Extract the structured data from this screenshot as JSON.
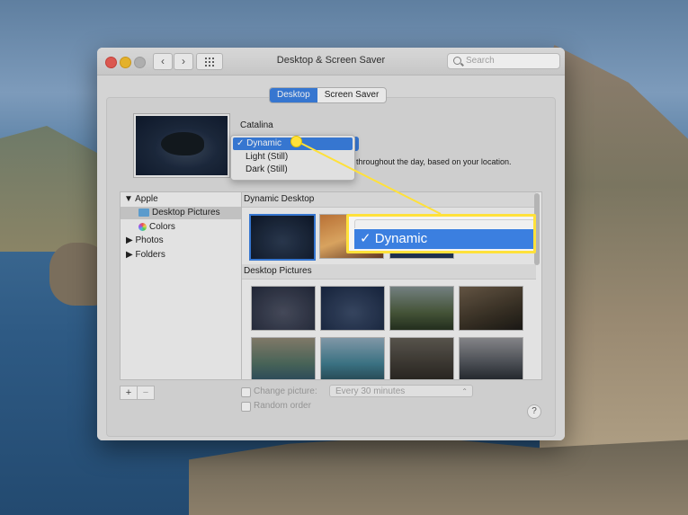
{
  "window": {
    "title": "Desktop & Screen Saver",
    "back_glyph": "‹",
    "forward_glyph": "›",
    "search_placeholder": "Search"
  },
  "tabs": [
    {
      "label": "Desktop",
      "active": true
    },
    {
      "label": "Screen Saver",
      "active": false
    }
  ],
  "current_picture": {
    "name": "Catalina",
    "description": "throughout the day, based on your location."
  },
  "appearance_menu": {
    "items": [
      {
        "label": "✓ Dynamic",
        "selected": true
      },
      {
        "label": "Light (Still)",
        "selected": false
      },
      {
        "label": "Dark (Still)",
        "selected": false
      }
    ]
  },
  "sidebar": {
    "items": [
      {
        "label": "▼ Apple"
      },
      {
        "label": "Desktop Pictures",
        "selected": true
      },
      {
        "label": "Colors"
      },
      {
        "label": "▶ Photos"
      },
      {
        "label": "▶ Folders"
      }
    ]
  },
  "gallery": {
    "dynamic_header": "Dynamic Desktop",
    "pictures_header": "Desktop Pictures"
  },
  "bottom": {
    "add_label": "+",
    "remove_label": "−",
    "change_picture_label": "Change picture:",
    "interval_value": "Every 30 minutes",
    "random_order_label": "Random order",
    "help_label": "?"
  },
  "callout": {
    "zoomed_label": "✓ Dynamic"
  },
  "colors": {
    "accent": "#3b7fe0",
    "highlight": "#ffe13a"
  }
}
